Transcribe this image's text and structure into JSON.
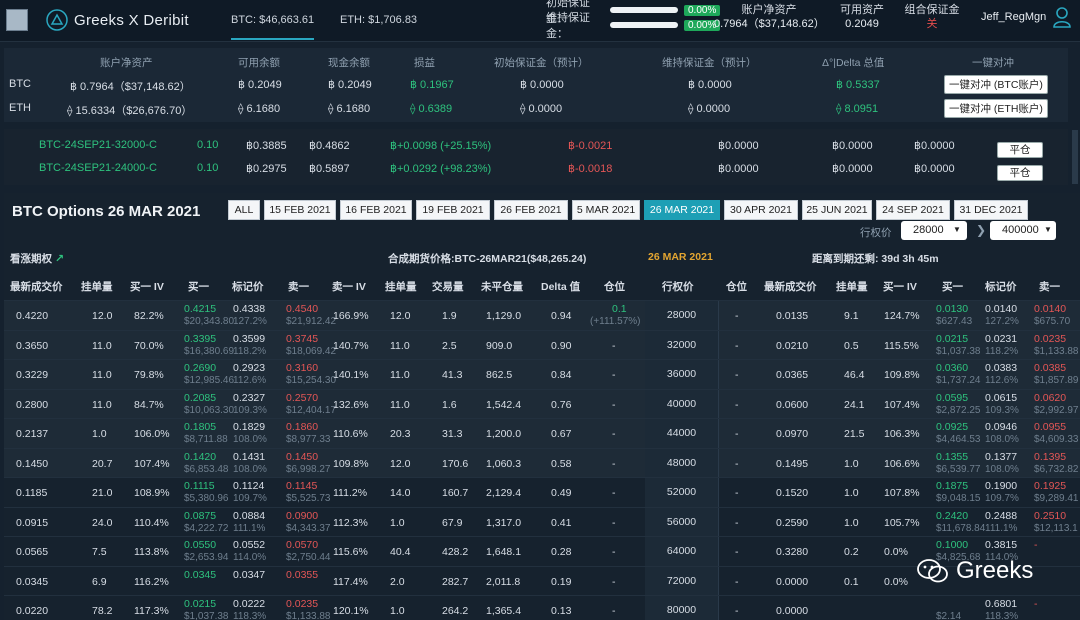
{
  "header": {
    "brand": "Greeks X Deribit",
    "btc_tab": "BTC: $46,663.61",
    "eth_tab": "ETH: $1,706.83",
    "initial_margin_label": "初始保证金：",
    "initial_margin_pct": "0.00%",
    "maint_margin_label": "维持保证金：",
    "maint_margin_pct": "0.00%",
    "net_label": "账户净资产",
    "net_value": "0.7964（$37,148.62）",
    "avail_label": "可用资产",
    "avail_value": "0.2049",
    "portfolio_label": "组合保证金",
    "portfolio_value": "关",
    "user": "Jeff_RegMgn"
  },
  "account": {
    "headers": [
      "账户净资产",
      "可用余额",
      "现金余额",
      "损益",
      "初始保证金（预计）",
      "维持保证金（预计）",
      "Δ°|Delta 总值",
      "一键对冲"
    ],
    "rows": [
      {
        "coin": "BTC",
        "net": "฿ 0.7964（$37,148.62）",
        "avail": "฿ 0.2049",
        "cash": "฿ 0.2049",
        "pnl": "฿ 0.1967",
        "im": "฿ 0.0000",
        "mm": "฿ 0.0000",
        "delta": "฿ 0.5337",
        "hedge": "一键对冲 (BTC账户)"
      },
      {
        "coin": "ETH",
        "net": "⟠ 15.6334（$26,676.70）",
        "avail": "⟠ 6.1680",
        "cash": "⟠ 6.1680",
        "pnl": "⟠ 0.6389",
        "im": "⟠ 0.0000",
        "mm": "⟠ 0.0000",
        "delta": "⟠ 8.0951",
        "hedge": "一键对冲 (ETH账户)"
      }
    ]
  },
  "positions": [
    {
      "instrument": "BTC-24SEP21-32000-C",
      "size": "0.10",
      "mark": "฿0.3885",
      "avg": "฿0.4862",
      "pnl": "฿+0.0098 (+25.15%)",
      "delta": "฿-0.0021",
      "c1": "฿0.0000",
      "c2": "฿0.0000",
      "c3": "฿0.0000",
      "btn": "平仓"
    },
    {
      "instrument": "BTC-24SEP21-24000-C",
      "size": "0.10",
      "mark": "฿0.2975",
      "avg": "฿0.5897",
      "pnl": "฿+0.0292 (+98.23%)",
      "delta": "฿-0.0018",
      "c1": "฿0.0000",
      "c2": "฿0.0000",
      "c3": "฿0.0000",
      "btn": "平仓"
    }
  ],
  "options": {
    "title": "BTC Options 26 MAR 2021",
    "dates": [
      "ALL",
      "15 FEB 2021",
      "16 FEB 2021",
      "19 FEB 2021",
      "26 FEB 2021",
      "5 MAR 2021",
      "26 MAR 2021",
      "30 APR 2021",
      "25 JUN 2021",
      "24 SEP 2021",
      "31 DEC 2021"
    ],
    "active_date": "26 MAR 2021",
    "strike_label": "行权价",
    "strike_from": "28000",
    "strike_to": "400000",
    "bull_label": "看涨期权",
    "futures_price": "合成期货价格:BTC-26MAR21($48,265.24)",
    "expiry_date": "26 MAR 2021",
    "countdown": "距离到期还剩: 39d 3h 45m",
    "call_headers": [
      "最新成交价",
      "挂单量",
      "买一 IV",
      "买一",
      "标记价",
      "卖一",
      "卖一 IV",
      "挂单量",
      "交易量",
      "未平仓量",
      "Delta 值",
      "仓位",
      "行权价"
    ],
    "put_headers": [
      "仓位",
      "最新成交价",
      "挂单量",
      "买一 IV",
      "买一",
      "标记价",
      "卖一"
    ],
    "rows": [
      {
        "last": "0.4220",
        "bsz": "12.0",
        "biv": "82.2%",
        "bid": "0.4215",
        "bidusd": "$20,343.80",
        "mark": "0.4338",
        "markiv": "127.2%",
        "ask": "0.4540",
        "askusd": "$21,912.42",
        "aiv": "166.9%",
        "asz": "12.0",
        "vol": "1.9",
        "oi": "1,129.0",
        "delta": "0.94",
        "pos": "0.1",
        "pospnl": "(+111.57%)",
        "strike": "28000",
        "ppos": "-",
        "plast": "0.0135",
        "pbsz": "9.1",
        "pbiv": "124.7%",
        "pbid": "0.0130",
        "pbidusd": "$627.43",
        "pmark": "0.0140",
        "pmarkiv": "127.2%",
        "pask": "0.0140",
        "paskusd": "$675.70"
      },
      {
        "last": "0.3650",
        "bsz": "11.0",
        "biv": "70.0%",
        "bid": "0.3395",
        "bidusd": "$16,380.69",
        "mark": "0.3599",
        "markiv": "118.2%",
        "ask": "0.3745",
        "askusd": "$18,069.42",
        "aiv": "140.7%",
        "asz": "11.0",
        "vol": "2.5",
        "oi": "909.0",
        "delta": "0.90",
        "pos": "-",
        "pospnl": "",
        "strike": "32000",
        "ppos": "-",
        "plast": "0.0210",
        "pbsz": "0.5",
        "pbiv": "115.5%",
        "pbid": "0.0215",
        "pbidusd": "$1,037.38",
        "pmark": "0.0231",
        "pmarkiv": "118.2%",
        "pask": "0.0235",
        "paskusd": "$1,133.88"
      },
      {
        "last": "0.3229",
        "bsz": "11.0",
        "biv": "79.8%",
        "bid": "0.2690",
        "bidusd": "$12,985.46",
        "mark": "0.2923",
        "markiv": "112.6%",
        "ask": "0.3160",
        "askusd": "$15,254.30",
        "aiv": "140.1%",
        "asz": "11.0",
        "vol": "41.3",
        "oi": "862.5",
        "delta": "0.84",
        "pos": "-",
        "pospnl": "",
        "strike": "36000",
        "ppos": "-",
        "plast": "0.0365",
        "pbsz": "46.4",
        "pbiv": "109.8%",
        "pbid": "0.0360",
        "pbidusd": "$1,737.24",
        "pmark": "0.0383",
        "pmarkiv": "112.6%",
        "pask": "0.0385",
        "paskusd": "$1,857.89"
      },
      {
        "last": "0.2800",
        "bsz": "11.0",
        "biv": "84.7%",
        "bid": "0.2085",
        "bidusd": "$10,063.30",
        "mark": "0.2327",
        "markiv": "109.3%",
        "ask": "0.2570",
        "askusd": "$12,404.17",
        "aiv": "132.6%",
        "asz": "11.0",
        "vol": "1.6",
        "oi": "1,542.4",
        "delta": "0.76",
        "pos": "-",
        "pospnl": "",
        "strike": "40000",
        "ppos": "-",
        "plast": "0.0600",
        "pbsz": "24.1",
        "pbiv": "107.4%",
        "pbid": "0.0595",
        "pbidusd": "$2,872.25",
        "pmark": "0.0615",
        "pmarkiv": "109.3%",
        "pask": "0.0620",
        "paskusd": "$2,992.97"
      },
      {
        "last": "0.2137",
        "bsz": "1.0",
        "biv": "106.0%",
        "bid": "0.1805",
        "bidusd": "$8,711.88",
        "mark": "0.1829",
        "markiv": "108.0%",
        "ask": "0.1860",
        "askusd": "$8,977.33",
        "aiv": "110.6%",
        "asz": "20.3",
        "vol": "31.3",
        "oi": "1,200.0",
        "delta": "0.67",
        "pos": "-",
        "pospnl": "",
        "strike": "44000",
        "ppos": "-",
        "plast": "0.0970",
        "pbsz": "21.5",
        "pbiv": "106.3%",
        "pbid": "0.0925",
        "pbidusd": "$4,464.53",
        "pmark": "0.0946",
        "pmarkiv": "108.0%",
        "pask": "0.0955",
        "paskusd": "$4,609.33"
      },
      {
        "last": "0.1450",
        "bsz": "20.7",
        "biv": "107.4%",
        "bid": "0.1420",
        "bidusd": "$6,853.48",
        "mark": "0.1431",
        "markiv": "108.0%",
        "ask": "0.1450",
        "askusd": "$6,998.27",
        "aiv": "109.8%",
        "asz": "12.0",
        "vol": "170.6",
        "oi": "1,060.3",
        "delta": "0.58",
        "pos": "-",
        "pospnl": "",
        "strike": "48000",
        "ppos": "-",
        "plast": "0.1495",
        "pbsz": "1.0",
        "pbiv": "106.6%",
        "pbid": "0.1355",
        "pbidusd": "$6,539.77",
        "pmark": "0.1377",
        "pmarkiv": "108.0%",
        "pask": "0.1395",
        "paskusd": "$6,732.82"
      },
      {
        "last": "0.1185",
        "bsz": "21.0",
        "biv": "108.9%",
        "bid": "0.1115",
        "bidusd": "$5,380.96",
        "mark": "0.1124",
        "markiv": "109.7%",
        "ask": "0.1145",
        "askusd": "$5,525.73",
        "aiv": "111.2%",
        "asz": "14.0",
        "vol": "160.7",
        "oi": "2,129.4",
        "delta": "0.49",
        "pos": "-",
        "pospnl": "",
        "strike": "52000",
        "ppos": "-",
        "plast": "0.1520",
        "pbsz": "1.0",
        "pbiv": "107.8%",
        "pbid": "0.1875",
        "pbidusd": "$9,048.15",
        "pmark": "0.1900",
        "pmarkiv": "109.7%",
        "pask": "0.1925",
        "paskusd": "$9,289.41"
      },
      {
        "last": "0.0915",
        "bsz": "24.0",
        "biv": "110.4%",
        "bid": "0.0875",
        "bidusd": "$4,222.72",
        "mark": "0.0884",
        "markiv": "111.1%",
        "ask": "0.0900",
        "askusd": "$4,343.37",
        "aiv": "112.3%",
        "asz": "1.0",
        "vol": "67.9",
        "oi": "1,317.0",
        "delta": "0.41",
        "pos": "-",
        "pospnl": "",
        "strike": "56000",
        "ppos": "-",
        "plast": "0.2590",
        "pbsz": "1.0",
        "pbiv": "105.7%",
        "pbid": "0.2420",
        "pbidusd": "$11,678.84",
        "pmark": "0.2488",
        "pmarkiv": "111.1%",
        "pask": "0.2510",
        "paskusd": "$12,113.1"
      },
      {
        "last": "0.0565",
        "bsz": "7.5",
        "biv": "113.8%",
        "bid": "0.0550",
        "bidusd": "$2,653.94",
        "mark": "0.0552",
        "markiv": "114.0%",
        "ask": "0.0570",
        "askusd": "$2,750.44",
        "aiv": "115.6%",
        "asz": "40.4",
        "vol": "428.2",
        "oi": "1,648.1",
        "delta": "0.28",
        "pos": "-",
        "pospnl": "",
        "strike": "64000",
        "ppos": "-",
        "plast": "0.3280",
        "pbsz": "0.2",
        "pbiv": "0.0%",
        "pbid": "0.1000",
        "pbidusd": "$4,825.68",
        "pmark": "0.3815",
        "pmarkiv": "114.0%",
        "pask": "-",
        "paskusd": ""
      },
      {
        "last": "0.0345",
        "bsz": "6.9",
        "biv": "116.2%",
        "bid": "0.0345",
        "bidusd": "",
        "mark": "0.0347",
        "markiv": "",
        "ask": "0.0355",
        "askusd": "",
        "aiv": "117.4%",
        "asz": "2.0",
        "vol": "282.7",
        "oi": "2,011.8",
        "delta": "0.19",
        "pos": "-",
        "pospnl": "",
        "strike": "72000",
        "ppos": "-",
        "plast": "0.0000",
        "pbsz": "0.1",
        "pbiv": "0.0%",
        "pbid": "",
        "pbidusd": "",
        "pmark": "",
        "pmarkiv": "",
        "pask": "",
        "paskusd": ""
      },
      {
        "last": "0.0220",
        "bsz": "78.2",
        "biv": "117.3%",
        "bid": "0.0215",
        "bidusd": "$1,037.38",
        "mark": "0.0222",
        "markiv": "118.3%",
        "ask": "0.0235",
        "askusd": "$1,133.88",
        "aiv": "120.1%",
        "asz": "1.0",
        "vol": "264.2",
        "oi": "1,365.4",
        "delta": "0.13",
        "pos": "-",
        "pospnl": "",
        "strike": "80000",
        "ppos": "-",
        "plast": "0.0000",
        "pbsz": "",
        "pbiv": "",
        "pbid": "",
        "pbidusd": "$2.14",
        "pmark": "0.6801",
        "pmarkiv": "118.3%",
        "pask": "-",
        "paskusd": ""
      }
    ]
  },
  "watermark": "Greeks"
}
